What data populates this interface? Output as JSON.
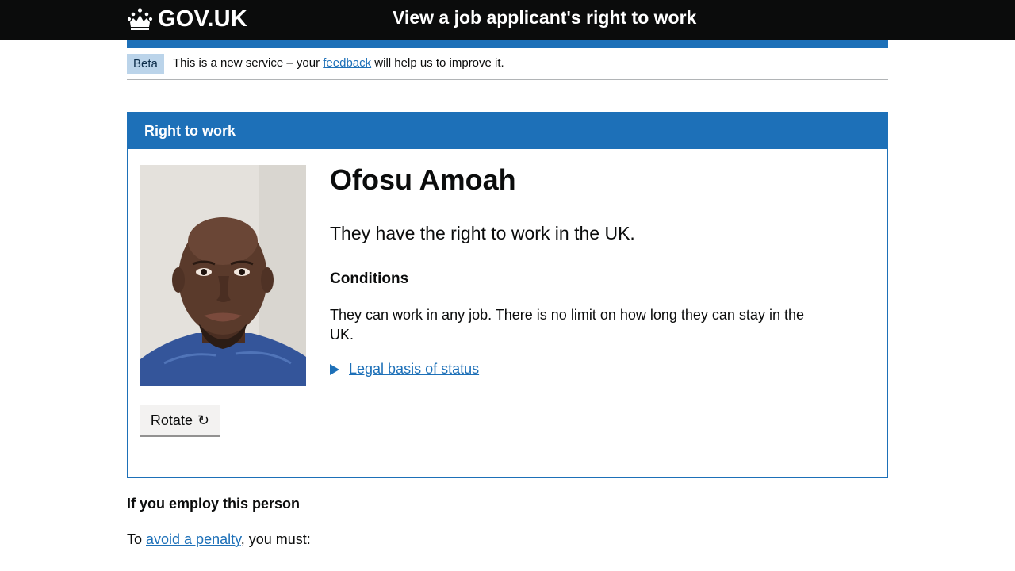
{
  "header": {
    "logo_text": "GOV.UK",
    "service_name": "View a job applicant's right to work"
  },
  "phase_banner": {
    "tag": "Beta",
    "text_before": "This is a new service – your ",
    "link": "feedback",
    "text_after": " will help us to improve it."
  },
  "card": {
    "title": "Right to work",
    "name": "Ofosu Amoah",
    "status": "They have the right to work in the UK.",
    "conditions_heading": "Conditions",
    "conditions_text": "They can work in any job. There is no limit on how long they can stay in the UK.",
    "details_summary": "Legal basis of status",
    "rotate_label": "Rotate",
    "rotate_icon": "↻"
  },
  "employ": {
    "heading": "If you employ this person",
    "text_before": "To ",
    "link": "avoid a penalty",
    "text_after": ", you must:"
  },
  "colors": {
    "header_bg": "#0b0c0c",
    "brand_blue": "#1d70b8",
    "tag_bg": "#bbd4ea"
  }
}
